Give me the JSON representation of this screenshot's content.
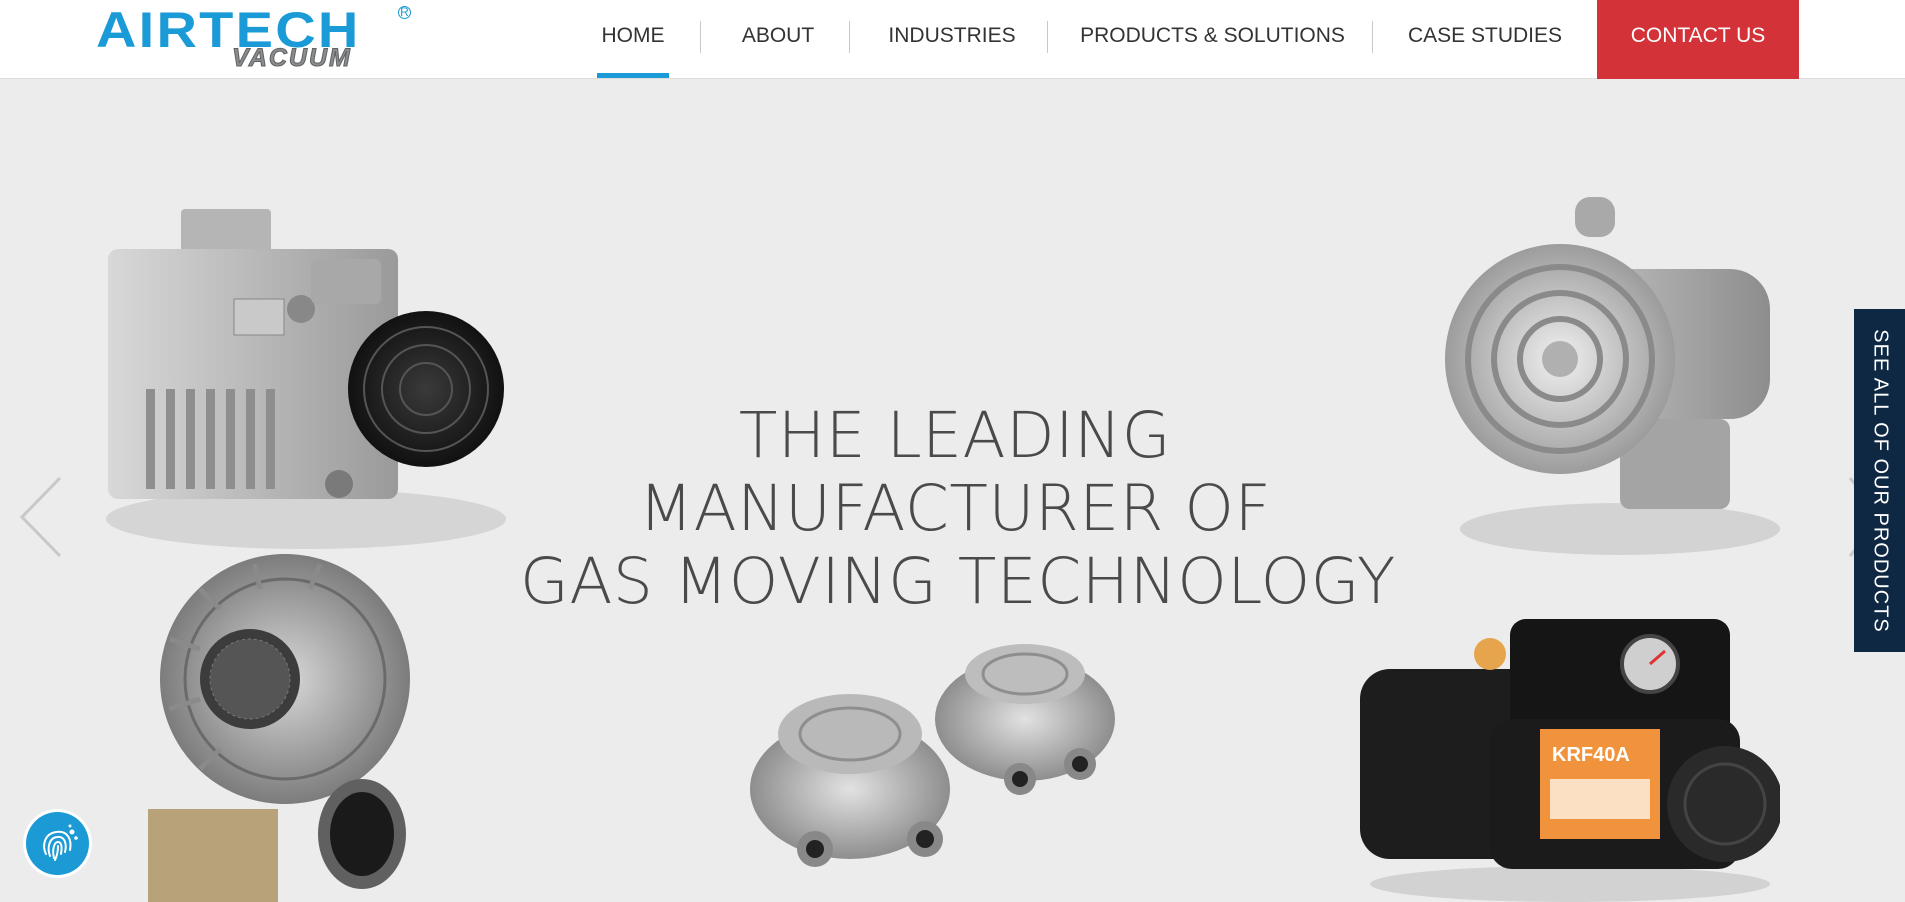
{
  "brand": {
    "name": "AIRTECH",
    "subname": "VACUUM",
    "registered_mark": "R",
    "accent_color": "#1a9ad6"
  },
  "nav": {
    "items": [
      {
        "label": "HOME",
        "active": true
      },
      {
        "label": "ABOUT",
        "active": false
      },
      {
        "label": "INDUSTRIES",
        "active": false
      },
      {
        "label": "PRODUCTS & SOLUTIONS",
        "active": false
      },
      {
        "label": "CASE STUDIES",
        "active": false
      }
    ],
    "contact_label": "CONTACT US",
    "contact_color": "#d33338"
  },
  "hero": {
    "headline": [
      "THE LEADING",
      "MANUFACTURER OF",
      "GAS MOVING TECHNOLOGY"
    ],
    "products": [
      {
        "icon": "rotary-vane-pump-icon"
      },
      {
        "icon": "regenerative-blower-icon"
      },
      {
        "icon": "centrifugal-blower-icon"
      },
      {
        "icon": "compact-pump-pair-icon"
      },
      {
        "icon": "oil-vane-pump-icon",
        "label": "KRF40A"
      }
    ],
    "prev_icon": "chevron-left-icon",
    "next_icon": "chevron-right-icon"
  },
  "side_tab": {
    "label": "SEE ALL OF OUR PRODUCTS",
    "color": "#0e2742"
  },
  "fingerprint_badge": {
    "icon": "fingerprint-icon"
  }
}
